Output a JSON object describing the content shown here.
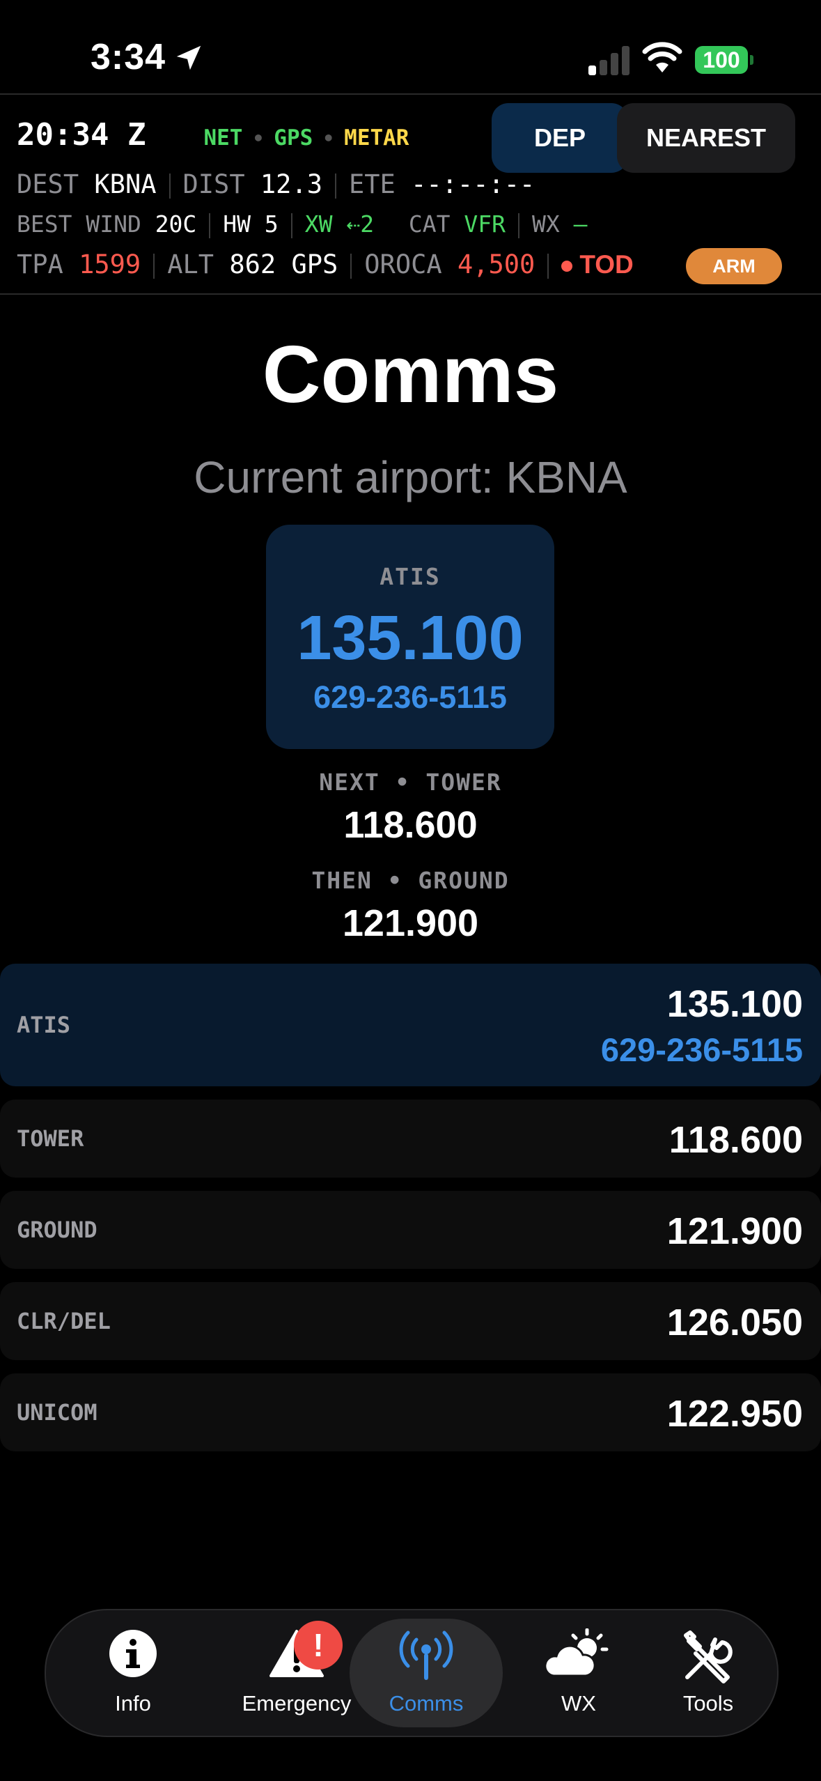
{
  "status_bar": {
    "time": "3:34",
    "battery": "100"
  },
  "header": {
    "zulu": "20:34 Z",
    "sources": [
      "NET",
      "GPS",
      "METAR"
    ],
    "dep_button": "DEP",
    "nearest_button": "NEAREST",
    "dest_label": "DEST",
    "dest_value": "KBNA",
    "dist_label": "DIST",
    "dist_value": "12.3",
    "ete_label": "ETE",
    "ete_value": "--:--:--",
    "best_wind_label": "BEST WIND",
    "best_wind_value": "20C",
    "hw": "HW 5",
    "xw_label": "XW",
    "xw_value": "⇠2",
    "cat_label": "CAT",
    "cat_value": "VFR",
    "wx_label": "WX",
    "wx_value": "—",
    "tpa_label": "TPA",
    "tpa_value": "1599",
    "alt_label": "ALT",
    "alt_value": "862",
    "alt_src": "GPS",
    "oroca_label": "OROCA",
    "oroca_value": "4,500",
    "tod_label": "TOD",
    "arm_button": "ARM"
  },
  "main": {
    "title": "Comms",
    "subtitle": "Current airport: KBNA",
    "atis_card": {
      "label": "ATIS",
      "freq": "135.100",
      "phone": "629-236-5115"
    },
    "next": {
      "label": "NEXT • TOWER",
      "freq": "118.600"
    },
    "then": {
      "label": "THEN • GROUND",
      "freq": "121.900"
    },
    "frequencies": [
      {
        "name": "ATIS",
        "freq": "135.100",
        "phone": "629-236-5115"
      },
      {
        "name": "TOWER",
        "freq": "118.600"
      },
      {
        "name": "GROUND",
        "freq": "121.900"
      },
      {
        "name": "CLR/DEL",
        "freq": "126.050"
      },
      {
        "name": "UNICOM",
        "freq": "122.950"
      }
    ]
  },
  "tabs": [
    {
      "label": "Info",
      "icon": "info-icon"
    },
    {
      "label": "Emergency",
      "icon": "warning-icon",
      "badge": "!"
    },
    {
      "label": "Comms",
      "icon": "antenna-icon",
      "active": true
    },
    {
      "label": "WX",
      "icon": "weather-icon"
    },
    {
      "label": "Tools",
      "icon": "tools-icon"
    }
  ],
  "colors": {
    "accent": "#3b8fe8",
    "green": "#4cd964",
    "red": "#ff5a4f",
    "yellow": "#ffd84a",
    "orange": "#e0883a"
  }
}
